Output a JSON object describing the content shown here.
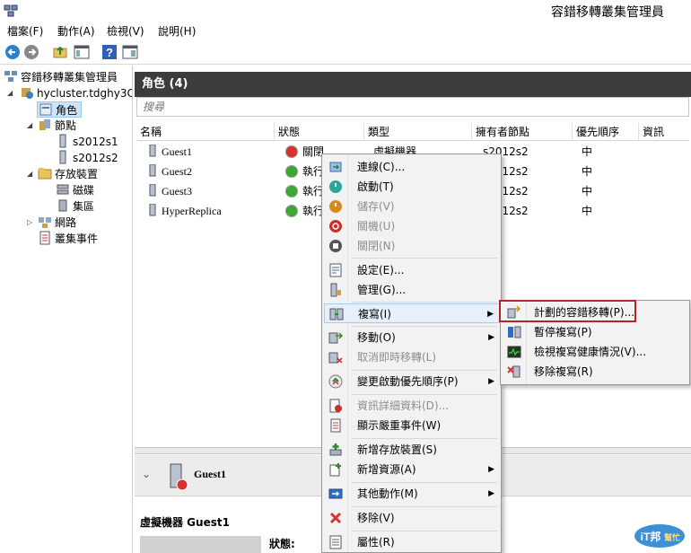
{
  "window": {
    "title": "容錯移轉叢集管理員"
  },
  "menubar": [
    {
      "label": "檔案(F)"
    },
    {
      "label": "動作(A)"
    },
    {
      "label": "檢視(V)"
    },
    {
      "label": "說明(H)"
    }
  ],
  "toolbar": {
    "icons": [
      "back-arrow-icon",
      "forward-arrow-icon",
      "folder-up-icon",
      "console-pane-icon",
      "help-icon",
      "action-pane-icon"
    ]
  },
  "tree": {
    "root": "容錯移轉叢集管理員",
    "cluster": "hycluster.tdghy3C",
    "roles": "角色",
    "nodes": "節點",
    "node1": "s2012s1",
    "node2": "s2012s2",
    "storage": "存放裝置",
    "disks": "磁碟",
    "pools": "集區",
    "networks": "網路",
    "events": "叢集事件"
  },
  "roles_panel": {
    "header": "角色 (4)",
    "search_placeholder": "搜尋",
    "columns": [
      "名稱",
      "狀態",
      "類型",
      "擁有者節點",
      "優先順序",
      "資訊"
    ],
    "rows": [
      {
        "name": "Guest1",
        "status": "關閉",
        "type": "虛擬機器",
        "owner": "s2012s2",
        "priority": "中",
        "status_color": "#d9322c"
      },
      {
        "name": "Guest2",
        "status": "執行",
        "type": "",
        "owner": "s2012s2",
        "priority": "中",
        "status_color": "#3aa835"
      },
      {
        "name": "Guest3",
        "status": "執行",
        "type": "",
        "owner": "s2012s2",
        "priority": "中",
        "status_color": "#3aa835"
      },
      {
        "name": "HyperReplica",
        "status": "執行",
        "type": "",
        "owner": "s2012s2",
        "priority": "中",
        "status_color": "#3aa835"
      }
    ]
  },
  "detail": {
    "title": "Guest1",
    "subtitle": "虛擬機器 Guest1",
    "status_label": "狀態:"
  },
  "context_menu": {
    "items": [
      {
        "label": "連線(C)...",
        "icon": "connect-icon",
        "enabled": true
      },
      {
        "label": "啟動(T)",
        "icon": "start-icon",
        "enabled": true
      },
      {
        "label": "儲存(V)",
        "icon": "save-icon",
        "enabled": false
      },
      {
        "label": "關機(U)",
        "icon": "shutdown-icon",
        "enabled": false
      },
      {
        "label": "關閉(N)",
        "icon": "turn-off-icon",
        "enabled": false
      },
      {
        "label": "設定(E)...",
        "icon": "settings-icon",
        "enabled": true
      },
      {
        "label": "管理(G)...",
        "icon": "manage-icon",
        "enabled": true
      },
      {
        "label": "複寫(I)",
        "icon": "replication-icon",
        "enabled": true
      },
      {
        "label": "移動(O)",
        "icon": "move-icon",
        "enabled": true
      },
      {
        "label": "取消即時移轉(L)",
        "icon": "cancel-migration-icon",
        "enabled": false
      },
      {
        "label": "變更啟動優先順序(P)",
        "icon": "priority-icon",
        "enabled": true
      },
      {
        "label": "資訊詳細資料(D)...",
        "icon": "info-details-icon",
        "enabled": false
      },
      {
        "label": "顯示嚴重事件(W)",
        "icon": "critical-events-icon",
        "enabled": true
      },
      {
        "label": "新增存放裝置(S)",
        "icon": "add-storage-icon",
        "enabled": true
      },
      {
        "label": "新增資源(A)",
        "icon": "add-resource-icon",
        "enabled": true
      },
      {
        "label": "其他動作(M)",
        "icon": "more-actions-icon",
        "enabled": true
      },
      {
        "label": "移除(V)",
        "icon": "remove-icon",
        "enabled": true
      },
      {
        "label": "屬性(R)",
        "icon": "properties-icon",
        "enabled": true
      }
    ]
  },
  "submenu": {
    "items": [
      {
        "label": "計劃的容錯移轉(P)...",
        "icon": "planned-failover-icon"
      },
      {
        "label": "暫停複寫(P)",
        "icon": "pause-replication-icon"
      },
      {
        "label": "檢視複寫健康情況(V)...",
        "icon": "replication-health-icon"
      },
      {
        "label": "移除複寫(R)",
        "icon": "remove-replication-icon"
      }
    ]
  },
  "watermark": {
    "text": "iT邦",
    "subtext": "幫忙"
  }
}
